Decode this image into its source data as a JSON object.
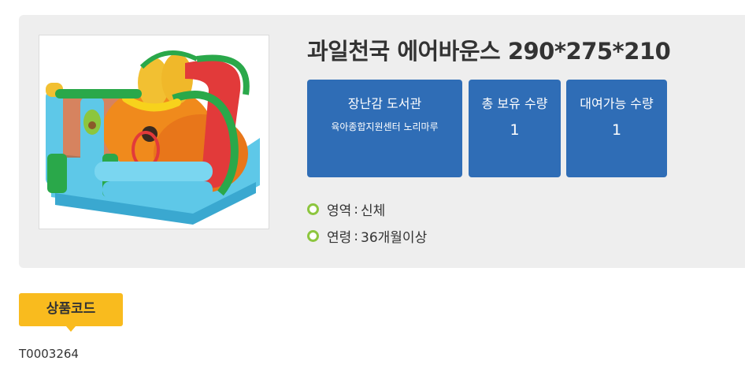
{
  "product": {
    "title": "과일천국 에어바운스 290*275*210",
    "image_alt": "과일천국 에어바운스"
  },
  "cards": [
    {
      "title": "장난감 도서관",
      "subtitle": "육아종합지원센터 노리마루"
    },
    {
      "title": "총 보유 수량",
      "value": "1"
    },
    {
      "title": "대여가능 수량",
      "value": "1"
    }
  ],
  "info": {
    "area_label": "영역",
    "area_value": "신체",
    "age_label": "연령",
    "age_value": "36개월이상",
    "separator": ":"
  },
  "code": {
    "label": "상품코드",
    "value": "T0003264"
  },
  "colors": {
    "card_bg": "#2f6db6",
    "badge_bg": "#f9bb1e",
    "bullet": "#8dc63f",
    "panel_bg": "#eeeeee"
  }
}
